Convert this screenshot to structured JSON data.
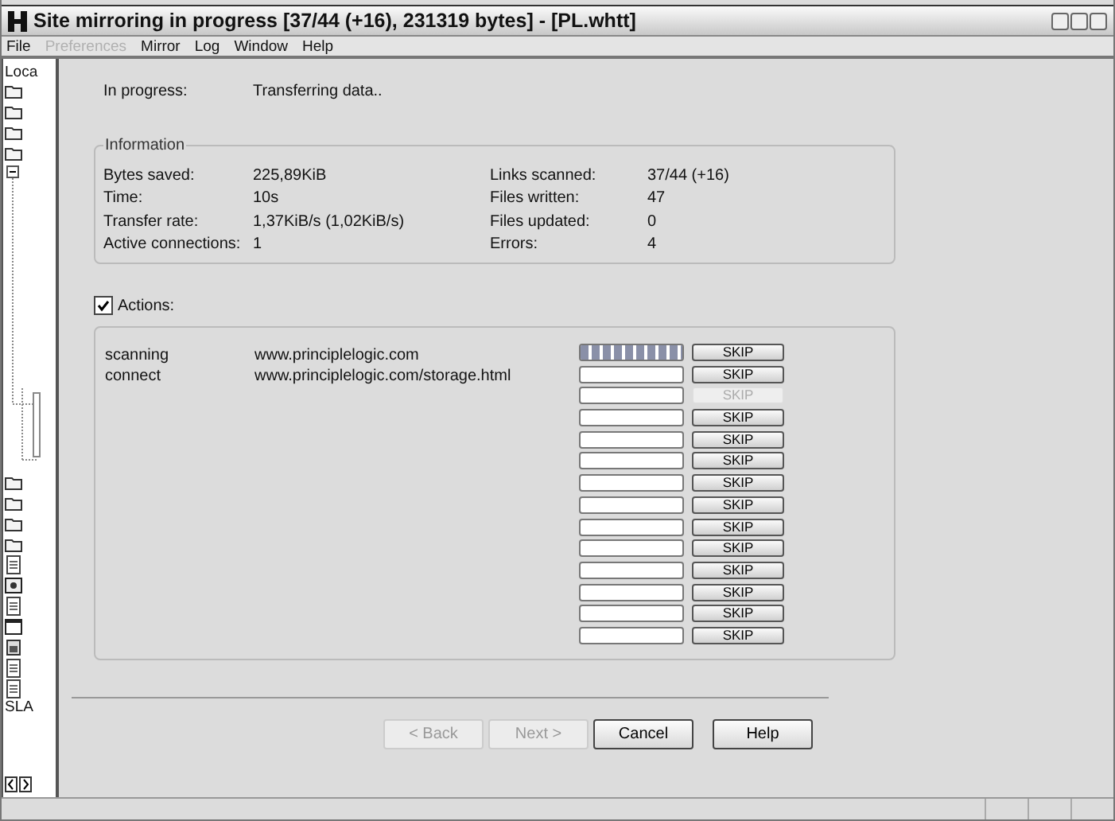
{
  "window": {
    "title": "Site mirroring in progress [37/44 (+16), 231319 bytes] - [PL.whtt]"
  },
  "menu": [
    {
      "label": "File",
      "disabled": false
    },
    {
      "label": "Preferences",
      "disabled": true
    },
    {
      "label": "Mirror",
      "disabled": false
    },
    {
      "label": "Log",
      "disabled": false
    },
    {
      "label": "Window",
      "disabled": false
    },
    {
      "label": "Help",
      "disabled": false
    }
  ],
  "sidebar": {
    "header": "Loca",
    "top_items": [
      {
        "kind": "folder"
      },
      {
        "kind": "folder"
      },
      {
        "kind": "folder"
      },
      {
        "kind": "folder"
      }
    ],
    "bottom_items": [
      {
        "kind": "folder"
      },
      {
        "kind": "folder"
      },
      {
        "kind": "folder"
      },
      {
        "kind": "folder"
      },
      {
        "kind": "document"
      },
      {
        "kind": "settings"
      },
      {
        "kind": "document"
      },
      {
        "kind": "window"
      },
      {
        "kind": "image"
      },
      {
        "kind": "document"
      },
      {
        "kind": "document"
      }
    ],
    "footer": "SLA"
  },
  "progress": {
    "label": "In progress:",
    "value": "Transferring data.."
  },
  "information": {
    "title": "Information",
    "rows": [
      {
        "label": "Bytes saved:",
        "value": "225,89KiB",
        "label_2": "Links scanned:",
        "value_2": "37/44 (+16)"
      },
      {
        "label": "Time:",
        "value": "10s",
        "label_2": "Files written:",
        "value_2": "47"
      },
      {
        "label": "Transfer rate:",
        "value": "1,37KiB/s (1,02KiB/s)",
        "label_2": "Files updated:",
        "value_2": "0"
      },
      {
        "label": "Active connections:",
        "value": "1",
        "label_2": "Errors:",
        "value_2": "4"
      }
    ]
  },
  "actions": {
    "label": "Actions:",
    "checked": true,
    "tasks": [
      {
        "status": "scanning",
        "url": "www.principlelogic.com"
      },
      {
        "status": "connect",
        "url": "www.principlelogic.com/storage.html"
      }
    ],
    "slots": [
      {
        "level": 1,
        "skip": "SKIP",
        "disabled": false
      },
      {
        "level": 0,
        "skip": "SKIP",
        "disabled": false
      },
      {
        "level": 0,
        "skip": "SKIP",
        "disabled": true
      },
      {
        "level": 0,
        "skip": "SKIP",
        "disabled": false
      },
      {
        "level": 0,
        "skip": "SKIP",
        "disabled": false
      },
      {
        "level": 0,
        "skip": "SKIP",
        "disabled": false
      },
      {
        "level": 0,
        "skip": "SKIP",
        "disabled": false
      },
      {
        "level": 0,
        "skip": "SKIP",
        "disabled": false
      },
      {
        "level": 0,
        "skip": "SKIP",
        "disabled": false
      },
      {
        "level": 0,
        "skip": "SKIP",
        "disabled": false
      },
      {
        "level": 0,
        "skip": "SKIP",
        "disabled": false
      },
      {
        "level": 0,
        "skip": "SKIP",
        "disabled": false
      },
      {
        "level": 0,
        "skip": "SKIP",
        "disabled": false
      },
      {
        "level": 0,
        "skip": "SKIP",
        "disabled": false
      }
    ]
  },
  "buttons": [
    {
      "label": "< Back",
      "disabled": true
    },
    {
      "label": "Next >",
      "disabled": true
    },
    {
      "label": "Cancel",
      "disabled": false
    },
    {
      "label": "Help",
      "disabled": false
    }
  ]
}
